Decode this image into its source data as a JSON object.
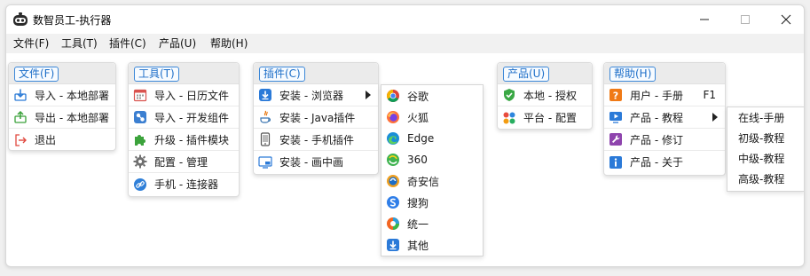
{
  "window": {
    "title": "数智员工-执行器"
  },
  "menubar": [
    "文件(F)",
    "工具(T)",
    "插件(C)",
    "产品(U)",
    "帮助(H)"
  ],
  "panels": {
    "file": {
      "head": "文件(F)",
      "items": [
        {
          "label": "导入 - 本地部署",
          "icon": "import-icon"
        },
        {
          "label": "导出 - 本地部署",
          "icon": "export-icon"
        },
        {
          "label": "退出",
          "icon": "exit-icon"
        }
      ]
    },
    "tools": {
      "head": "工具(T)",
      "items": [
        {
          "label": "导入 - 日历文件",
          "icon": "calendar-icon"
        },
        {
          "label": "导入 - 开发组件",
          "icon": "component-icon"
        },
        {
          "label": "升级 - 插件模块",
          "icon": "puzzle-icon"
        },
        {
          "label": "配置 - 管理",
          "icon": "gear-icon"
        },
        {
          "label": "手机 - 连接器",
          "icon": "link-icon"
        }
      ]
    },
    "plugins": {
      "head": "插件(C)",
      "items": [
        {
          "label": "安装 - 浏览器",
          "icon": "download-icon"
        },
        {
          "label": "安装 - Java插件",
          "icon": "java-icon"
        },
        {
          "label": "安装 - 手机插件",
          "icon": "phone-icon"
        },
        {
          "label": "安装 - 画中画",
          "icon": "pip-icon"
        }
      ]
    },
    "browsers": {
      "items": [
        {
          "label": "谷歌",
          "icon": "chrome-icon"
        },
        {
          "label": "火狐",
          "icon": "firefox-icon"
        },
        {
          "label": "Edge",
          "icon": "edge-icon"
        },
        {
          "label": "360",
          "icon": "360-browser-icon"
        },
        {
          "label": "奇安信",
          "icon": "qianxin-icon"
        },
        {
          "label": "搜狗",
          "icon": "sogou-icon"
        },
        {
          "label": "统一",
          "icon": "unified-browser-icon"
        },
        {
          "label": "其他",
          "icon": "other-download-icon"
        }
      ]
    },
    "products": {
      "head": "产品(U)",
      "items": [
        {
          "label": "本地 - 授权",
          "icon": "shield-check-icon"
        },
        {
          "label": "平台 - 配置",
          "icon": "apps-icon"
        }
      ]
    },
    "help": {
      "head": "帮助(H)",
      "items": [
        {
          "label": "用户 - 手册",
          "icon": "question-icon",
          "shortcut": "F1"
        },
        {
          "label": "产品 - 教程",
          "icon": "video-icon"
        },
        {
          "label": "产品 - 修订",
          "icon": "wrench-icon"
        },
        {
          "label": "产品 - 关于",
          "icon": "info-icon"
        }
      ]
    },
    "tutorials": {
      "items": [
        {
          "label": "在线-手册"
        },
        {
          "label": "初级-教程"
        },
        {
          "label": "中级-教程"
        },
        {
          "label": "高级-教程"
        }
      ]
    }
  },
  "colors": {
    "accent": "#1c6ec8",
    "panel_head": "#ebebeb",
    "menubar": "#f1f1f1"
  }
}
